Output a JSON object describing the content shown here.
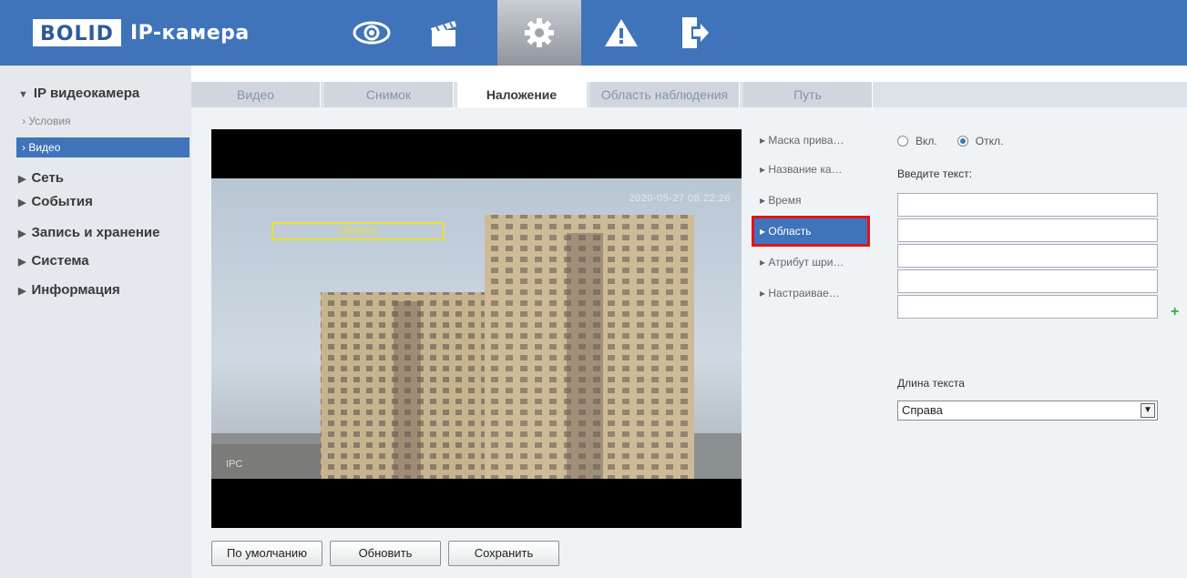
{
  "header": {
    "logo_brand": "BOLID",
    "logo_text": "IP-камера",
    "nav": [
      {
        "icon": "eye-icon"
      },
      {
        "icon": "clapperboard-icon"
      },
      {
        "icon": "gear-icon",
        "active": true
      },
      {
        "icon": "alarm-icon"
      },
      {
        "icon": "logout-icon"
      }
    ]
  },
  "sidebar": {
    "title": "IP видеокамера",
    "subitems": [
      "Условия",
      "Видео"
    ],
    "items": [
      "Сеть",
      "События",
      "Запись и хранение",
      "Система",
      "Информация"
    ]
  },
  "tabs": [
    "Видео",
    "Снимок",
    "Наложение",
    "Область наблюдения",
    "Путь"
  ],
  "active_tab": "Наложение",
  "video": {
    "timestamp": "2020-05-27 08:22:26",
    "region_label": "Область",
    "channel_label": "IPC"
  },
  "submenu": [
    "Маска прива…",
    "Название ка…",
    "Время",
    "Область",
    "Атрибут шри…",
    "Настраивае…"
  ],
  "panel": {
    "radio_on": "Вкл.",
    "radio_off": "Откл.",
    "enter_text_label": "Введите текст:",
    "text_length_label": "Длина текста",
    "alignment_value": "Справа"
  },
  "buttons": {
    "default": "По умолчанию",
    "refresh": "Обновить",
    "save": "Сохранить"
  },
  "colors": {
    "header": "#3f74ba",
    "highlight": "#e3121c"
  }
}
